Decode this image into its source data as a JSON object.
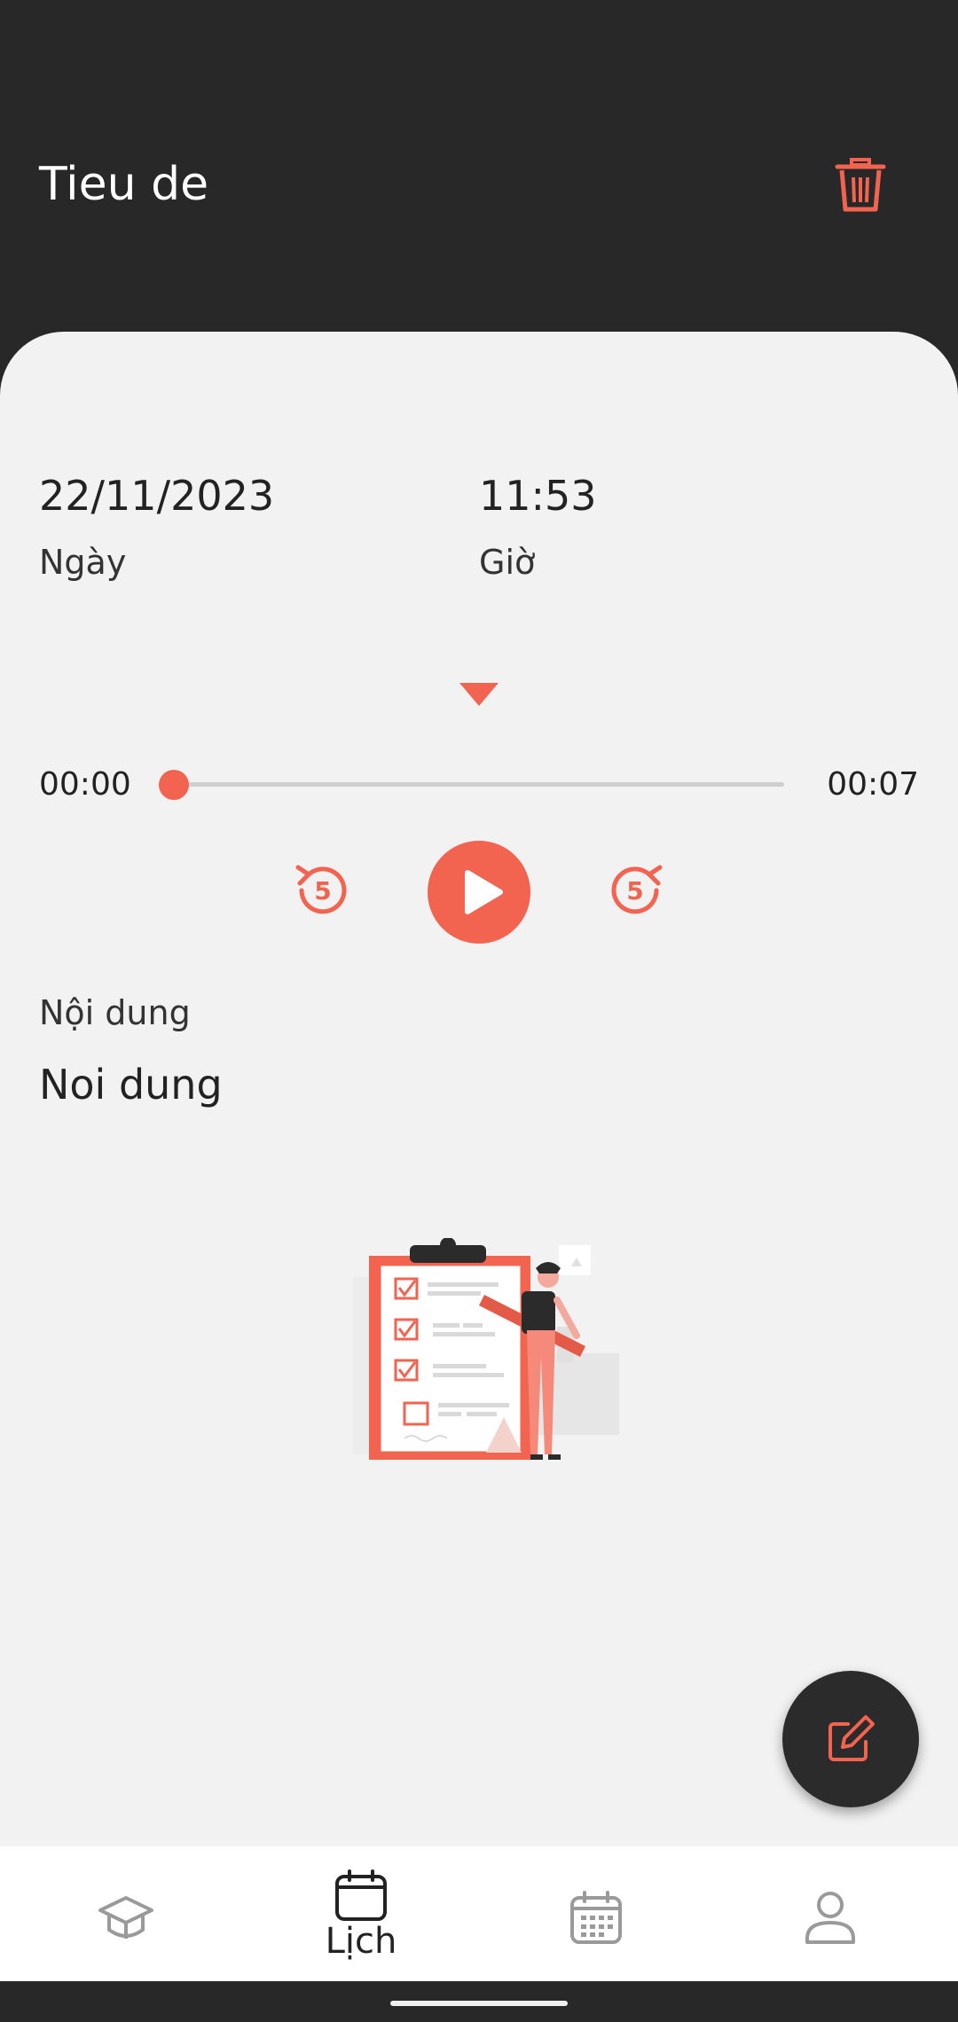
{
  "header": {
    "title": "Tieu de",
    "delete_icon": "trash-icon"
  },
  "details": {
    "date_value": "22/11/2023",
    "date_label": "Ngày",
    "time_value": "11:53",
    "time_label": "Giờ"
  },
  "player": {
    "current_time": "00:00",
    "total_time": "00:07",
    "progress": 0,
    "rewind_seconds": "5",
    "forward_seconds": "5",
    "expand_icon": "caret-down-icon",
    "play_icon": "play-icon"
  },
  "content": {
    "label": "Nội dung",
    "value": "Noi dung"
  },
  "fab": {
    "icon": "edit-icon"
  },
  "bottom_nav": {
    "items": [
      {
        "icon": "graduation-cap-icon",
        "label": ""
      },
      {
        "icon": "calendar-icon",
        "label": "Lịch",
        "active": true
      },
      {
        "icon": "calendar-grid-icon",
        "label": ""
      },
      {
        "icon": "user-icon",
        "label": ""
      }
    ]
  },
  "colors": {
    "accent": "#f26350",
    "dark": "#282829",
    "surface": "#f2f2f2"
  }
}
